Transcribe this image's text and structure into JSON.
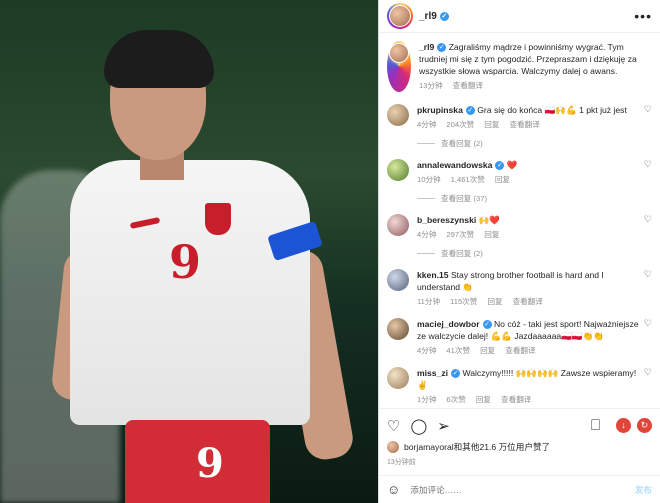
{
  "header": {
    "username": "_rl9"
  },
  "caption": {
    "username": "_rl9",
    "text": "Zagraliśmy mądrze i powinniśmy wygrać. Tym trudniej mi się z tym pogodzić. Przepraszam i dziękuję za wszystkie słowa wsparcia. Walczymy dalej o awans.",
    "time": "13分钟",
    "translate": "查看翻译"
  },
  "comments": [
    {
      "username": "pkrupinska",
      "text": "Gra się do końca 🇵🇱🙌💪 1 pkt już jest",
      "time": "4分钟",
      "likes": "204次赞",
      "reply": "回复",
      "translate": "查看翻译",
      "view_replies": "查看回复 (2)"
    },
    {
      "username": "annalewandowska",
      "text": "❤️",
      "time": "10分钟",
      "likes": "1,461次赞",
      "reply": "回复",
      "translate": "",
      "view_replies": "查看回复 (37)"
    },
    {
      "username": "b_bereszynski",
      "text": "🙌❤️",
      "time": "4分钟",
      "likes": "297次赞",
      "reply": "回复",
      "translate": "",
      "view_replies": "查看回复 (2)"
    },
    {
      "username": "kken.15",
      "text": "Stay strong brother football is hard and I understand 👏",
      "time": "11分钟",
      "likes": "115次赞",
      "reply": "回复",
      "translate": "查看翻译",
      "view_replies": ""
    },
    {
      "username": "maciej_dowbor",
      "text": "No cóż - taki jest sport! Najważniejsze ze walczycie dalej! 💪💪 Jazdaaaaaa🇵🇱🇵🇱👏👏",
      "time": "4分钟",
      "likes": "41次赞",
      "reply": "回复",
      "translate": "查看翻译",
      "view_replies": ""
    },
    {
      "username": "miss_zi",
      "text": "Walczymy!!!!! 🙌🙌🙌🙌 Zawsze wspieramy! ✌️",
      "time": "1分钟",
      "likes": "6次赞",
      "reply": "回复",
      "translate": "查看翻译",
      "view_replies": ""
    }
  ],
  "likes_line": "borjamayoral和其他21.6 万位用户赞了",
  "post_time": "13分钟前",
  "add_comment": {
    "placeholder": "添加评论……",
    "post": "发布"
  },
  "colors": {
    "verified": "#3897f0",
    "heart": "#ed4956"
  }
}
